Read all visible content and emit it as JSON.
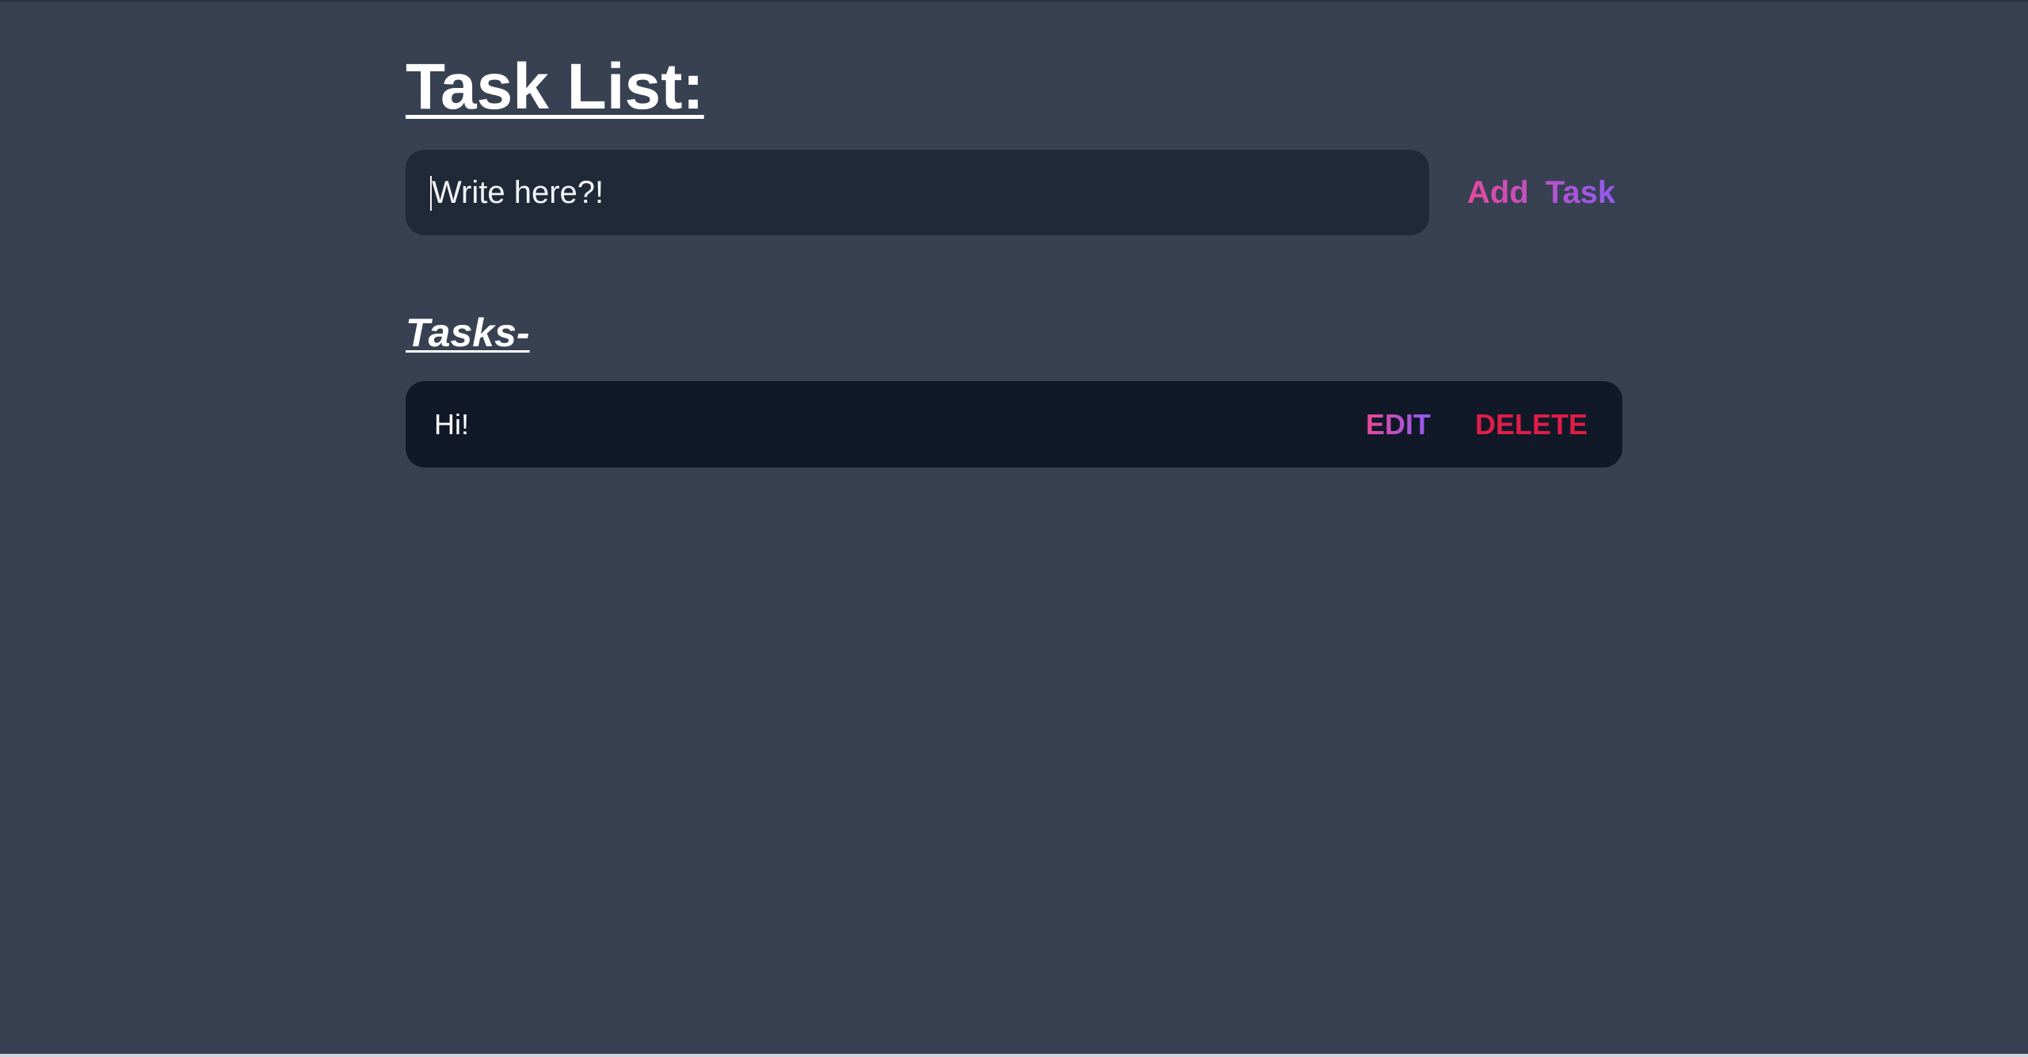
{
  "page": {
    "title": "Task List:",
    "background_color": "#374151"
  },
  "input": {
    "placeholder": "Write here?!",
    "value": ""
  },
  "add_button": {
    "label": "Add  Task",
    "gradient": [
      "#ec4899",
      "#8b5cf6"
    ]
  },
  "tasks_heading": "Tasks-",
  "tasks": [
    {
      "text": "Hi!",
      "edit_label": "EDIT",
      "delete_label": "DELETE"
    }
  ],
  "colors": {
    "input_bg": "#1f2937",
    "task_bg": "#111827",
    "delete": "#e11d48"
  }
}
